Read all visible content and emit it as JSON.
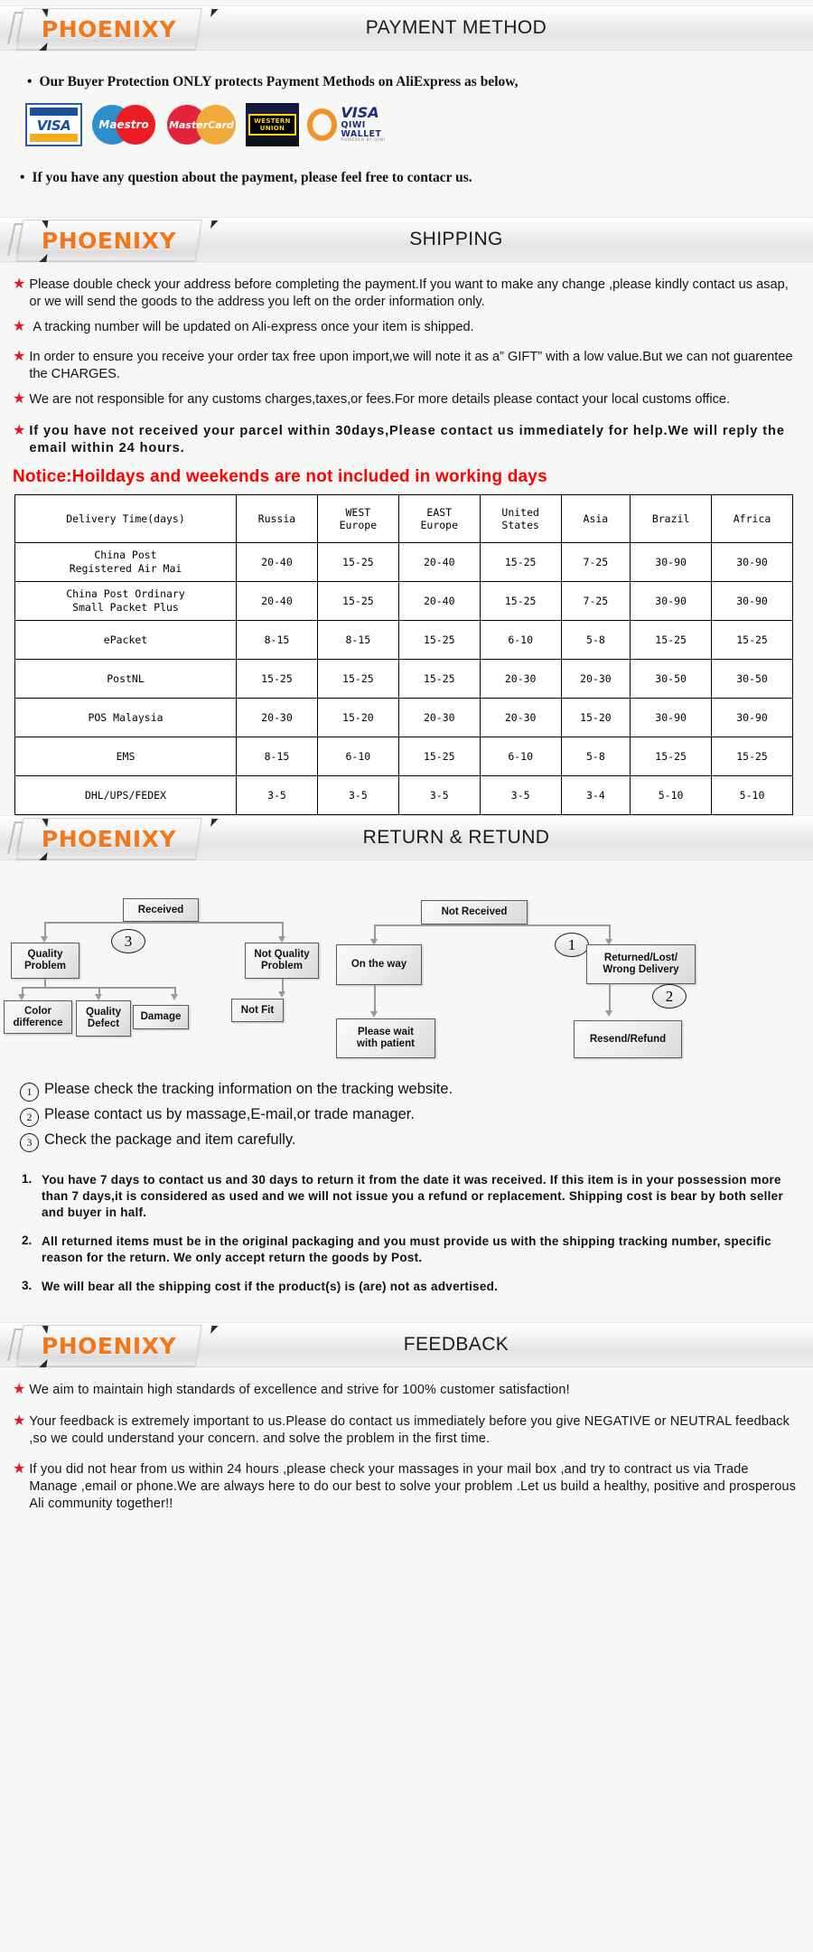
{
  "brand": "PHOENIXY",
  "sections": [
    {
      "id": "payment",
      "title": "PAYMENT METHOD"
    },
    {
      "id": "shipping",
      "title": "SHIPPING"
    },
    {
      "id": "return",
      "title": "RETURN & RETUND"
    },
    {
      "id": "feedback",
      "title": "FEEDBACK"
    }
  ],
  "payment": {
    "bullet1": "Our Buyer Protection ONLY protects Payment Methods on AliExpress as below,",
    "bullet2": "If you have any question about the payment, please feel free to contacr us.",
    "bullet_mark": "•",
    "logos": [
      {
        "name": "visa-logo",
        "label": "VISA"
      },
      {
        "name": "maestro-logo",
        "label": "Maestro"
      },
      {
        "name": "mastercard-logo",
        "label": "MasterCard"
      },
      {
        "name": "western-union-logo",
        "label_line1": "WESTERN",
        "label_line2": "UNION"
      },
      {
        "name": "qiwi-wallet-logo",
        "label": "VISA",
        "sub": "QIWI WALLET",
        "powered": "POWERED BY QIWI"
      }
    ]
  },
  "shipping": {
    "bullets": [
      "Please double check your address before completing the payment.If you want to make any change ,please kindly contact us asap, or we will send the goods to the address you left on the order information only.",
      "A tracking number will be updated on Ali-express once your item is shipped.",
      "In order to ensure you receive your order tax free upon import,we will note it as a” GIFT” with a low value.But we can not guarentee the CHARGES.",
      "We are not responsible for any customs charges,taxes,or fees.For more details please contact your local customs office.",
      "If you have not received your parcel within 30days,Please contact us immediately for help.We will reply the email within 24 hours."
    ],
    "notice": "Notice:Hoildays and weekends are not included in working days",
    "table": {
      "headers": [
        "Delivery Time(days)",
        "Russia",
        "WEST\nEurope",
        "EAST\nEurope",
        "United\nStates",
        "Asia",
        "Brazil",
        "Africa"
      ],
      "rows": [
        {
          "method": "China Post\nRegistered Air Mai",
          "values": [
            "20-40",
            "15-25",
            "20-40",
            "15-25",
            "7-25",
            "30-90",
            "30-90"
          ]
        },
        {
          "method": "China Post Ordinary\nSmall Packet Plus",
          "values": [
            "20-40",
            "15-25",
            "20-40",
            "15-25",
            "7-25",
            "30-90",
            "30-90"
          ]
        },
        {
          "method": "ePacket",
          "values": [
            "8-15",
            "8-15",
            "15-25",
            "6-10",
            "5-8",
            "15-25",
            "15-25"
          ]
        },
        {
          "method": "PostNL",
          "values": [
            "15-25",
            "15-25",
            "15-25",
            "20-30",
            "20-30",
            "30-50",
            "30-50"
          ]
        },
        {
          "method": "POS Malaysia",
          "values": [
            "20-30",
            "15-20",
            "20-30",
            "20-30",
            "15-20",
            "30-90",
            "30-90"
          ]
        },
        {
          "method": "EMS",
          "values": [
            "8-15",
            "6-10",
            "15-25",
            "6-10",
            "5-8",
            "15-25",
            "15-25"
          ]
        },
        {
          "method": "DHL/UPS/FEDEX",
          "values": [
            "3-5",
            "3-5",
            "3-5",
            "3-5",
            "3-4",
            "5-10",
            "5-10"
          ]
        }
      ]
    }
  },
  "flowchart": {
    "left": {
      "root": "Received",
      "badge": "3",
      "branch_a": "Quality\nProblem",
      "branch_b": "Not Quality\nProblem",
      "leaf_a1": "Color\ndifference",
      "leaf_a2": "Quality\nDefect",
      "leaf_a3": "Damage",
      "leaf_b1": "Not Fit"
    },
    "right": {
      "root": "Not  Received",
      "badge1": "1",
      "badge2": "2",
      "branch_a": "On the way",
      "branch_b": "Returned/Lost/\nWrong Delivery",
      "leaf_a1": "Please wait\nwith patient",
      "leaf_b1": "Resend/Refund"
    }
  },
  "circled_notes": [
    {
      "num": "①",
      "text": "Please check the tracking information on the tracking website."
    },
    {
      "num": "②",
      "text": "Please contact us by  massage,E-mail,or trade manager."
    },
    {
      "num": "③",
      "text": "Check the package and item carefully."
    }
  ],
  "return_terms": [
    {
      "num": "1.",
      "text": "You have 7 days to contact us and 30 days to return it from the date it was received. If this item is in your possession more than 7 days,it is considered as used and we will not issue you a refund or replacement. Shipping cost is bear by both seller and buyer in half."
    },
    {
      "num": "2.",
      "text": "All returned items must be in the original packaging and you must provide us with the shipping tracking number, specific reason for the return. We only accept return the goods by Post."
    },
    {
      "num": "3.",
      "text": "We will bear all the shipping cost if the product(s) is (are) not as advertised."
    }
  ],
  "feedback": {
    "bullets": [
      "We aim to maintain high standards of excellence and strive  for 100% customer satisfaction!",
      "Your feedback is extremely important to us.Please do contact us immediately before you give NEGATIVE or NEUTRAL feedback ,so  we could understand your concern. and solve the problem in the first time.",
      "If you did not hear from us within 24 hours ,please check your massages in your mail box ,and try to contract us via Trade Manage ,email or phone.We are always here to do our best to solve your problem .Let us build a healthy, positive and prosperous Ali community together!!"
    ]
  },
  "colors": {
    "brand_orange": "#f4761a",
    "star_red": "#e8152a",
    "notice_red": "#ff0000",
    "page_bg": "#f7f7f5"
  },
  "icons": {
    "star": "★",
    "bullet": "•"
  }
}
